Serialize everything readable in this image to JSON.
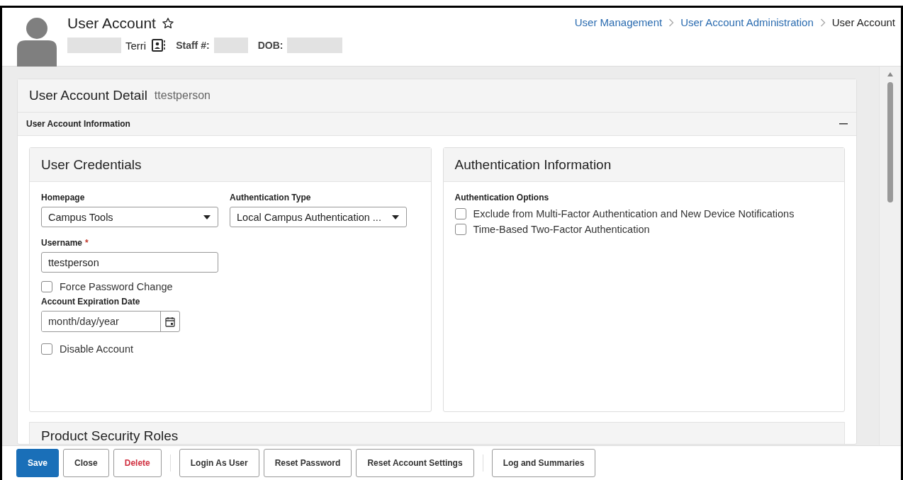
{
  "header": {
    "title": "User Account",
    "name": "Terri",
    "staff_label": "Staff #:",
    "dob_label": "DOB:"
  },
  "breadcrumbs": [
    {
      "label": "User Management",
      "selected": false
    },
    {
      "label": "User Account Administration",
      "selected": false
    },
    {
      "label": "User Account",
      "selected": true
    }
  ],
  "detail": {
    "title": "User Account Detail",
    "username": "ttestperson"
  },
  "section": {
    "title": "User Account Information",
    "expanded": true
  },
  "credentials": {
    "title": "User Credentials",
    "homepage": {
      "label": "Homepage",
      "value": "Campus Tools"
    },
    "auth_type": {
      "label": "Authentication Type",
      "value": "Local Campus Authentication ..."
    },
    "username": {
      "label": "Username",
      "required_mark": "*",
      "value": "ttestperson"
    },
    "force_password_change": {
      "label": "Force Password Change",
      "checked": false
    },
    "expiration": {
      "label": "Account Expiration Date",
      "placeholder": "month/day/year"
    },
    "disable_account": {
      "label": "Disable Account",
      "checked": false
    }
  },
  "authentication": {
    "title": "Authentication Information",
    "options_label": "Authentication Options",
    "options": [
      {
        "label": "Exclude from Multi-Factor Authentication and New Device Notifications",
        "checked": false
      },
      {
        "label": "Time-Based Two-Factor Authentication",
        "checked": false
      }
    ]
  },
  "next_section": {
    "title": "Product Security Roles"
  },
  "button_groups": [
    [
      {
        "label": "Save",
        "kind": "primary"
      },
      {
        "label": "Close",
        "kind": "default"
      },
      {
        "label": "Delete",
        "kind": "danger"
      }
    ],
    [
      {
        "label": "Login As User",
        "kind": "default"
      },
      {
        "label": "Reset Password",
        "kind": "default"
      },
      {
        "label": "Reset Account Settings",
        "kind": "default"
      }
    ],
    [
      {
        "label": "Log and Summaries",
        "kind": "default"
      }
    ]
  ]
}
